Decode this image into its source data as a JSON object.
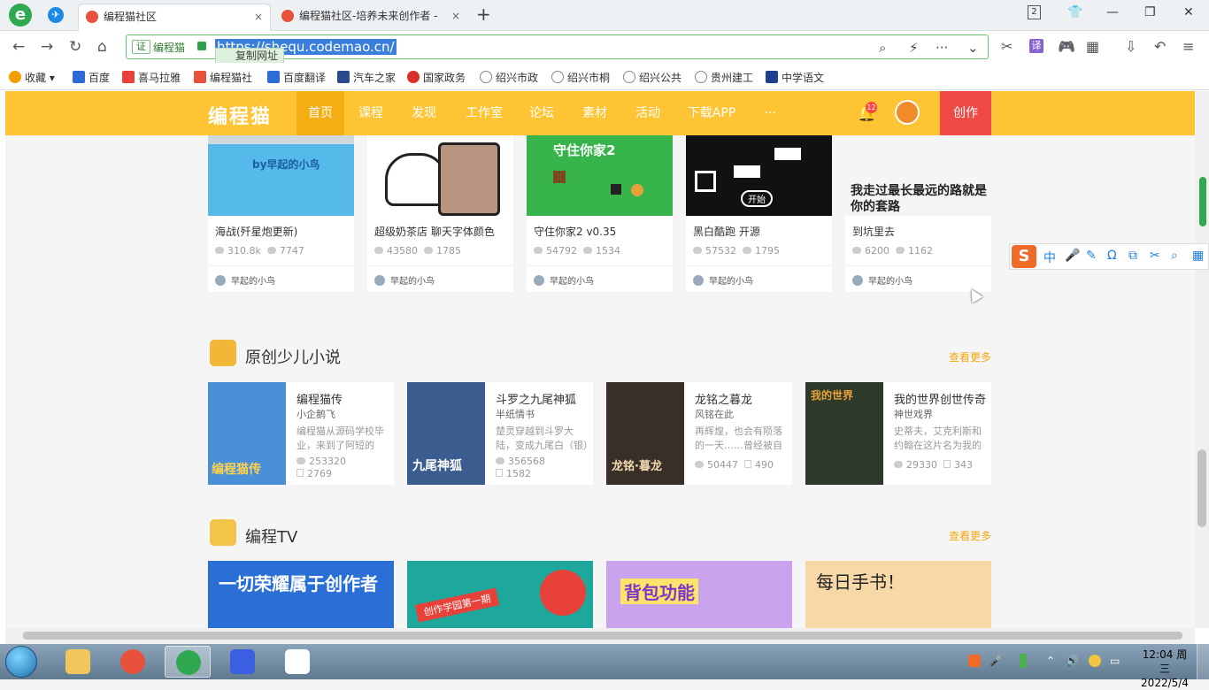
{
  "browser": {
    "tabs": [
      {
        "title": "编程猫社区",
        "close": "×"
      },
      {
        "title": "编程猫社区-培养未来创作者 -",
        "close": "×"
      }
    ],
    "new_tab": "+",
    "tab_count": "2",
    "window": {
      "minimize": "—",
      "maximize": "❐",
      "close": "✕"
    },
    "address": {
      "cert": "证",
      "site_name": "编程猫",
      "url": "https://shequ.codemao.cn/",
      "copy_tip": "复制网址"
    },
    "nav": {
      "back": "←",
      "forward": "→",
      "refresh": "↻",
      "home": "⌂"
    },
    "url_icons": {
      "search": "⌕",
      "flash": "⚡",
      "more": "···",
      "dropdown": "⌄"
    },
    "toolbar_icons": {
      "cut": "✂",
      "translate": "译",
      "game": "🎮",
      "apps": "▦",
      "download": "⇩",
      "undo": "↶",
      "menu": "≡"
    },
    "bookmarks": [
      {
        "label": "收藏",
        "color": "#f0a000"
      },
      {
        "label": "百度",
        "color": "#2f6bd6"
      },
      {
        "label": "喜马拉雅",
        "color": "#e8413a"
      },
      {
        "label": "编程猫社",
        "color": "#e8513b"
      },
      {
        "label": "百度翻译",
        "color": "#2f6bd6"
      },
      {
        "label": "汽车之家",
        "color": "#2a4a8e"
      },
      {
        "label": "国家政务",
        "color": "#d9302c"
      },
      {
        "label": "绍兴市政",
        "color": "#888888"
      },
      {
        "label": "绍兴市桐",
        "color": "#888888"
      },
      {
        "label": "绍兴公共",
        "color": "#888888"
      },
      {
        "label": "贵州建工",
        "color": "#888888"
      },
      {
        "label": "中学语文",
        "color": "#1f3f8f"
      }
    ]
  },
  "site": {
    "logo": "编程猫",
    "nav": [
      "首页",
      "课程",
      "发现",
      "工作室",
      "论坛",
      "素材",
      "活动",
      "下载APP",
      "···"
    ],
    "active_nav": "首页",
    "notifications": "12",
    "create": "创作",
    "games": [
      {
        "title": "海战(歼星炮更新)",
        "views": "310.8k",
        "likes": "7747",
        "author": "早起的小鸟",
        "thumb_text": "by早起的小鸟",
        "thumb_color": "#55b9ea"
      },
      {
        "title": "超级奶茶店 聊天字体颜色",
        "views": "43580",
        "likes": "1785",
        "author": "早起的小鸟",
        "thumb_text": "",
        "thumb_color": "#ffffff"
      },
      {
        "title": "守住你家2 v0.35",
        "views": "54792",
        "likes": "1534",
        "author": "早起的小鸟",
        "thumb_text": "守住你家2",
        "thumb_color": "#37b44a"
      },
      {
        "title": "黑白酷跑 开源",
        "views": "57532",
        "likes": "1795",
        "author": "早起的小鸟",
        "thumb_text": "开始",
        "thumb_color": "#111111"
      },
      {
        "title": "到坑里去",
        "views": "6200",
        "likes": "1162",
        "author": "早起的小鸟",
        "thumb_text": "我走过最长最远的路就是你的套路",
        "thumb_color": "#f5f5f5"
      }
    ],
    "novels_section": {
      "title": "原创少儿小说",
      "more": "查看更多"
    },
    "novels": [
      {
        "title": "编程猫传",
        "author": "小企鹅飞",
        "desc": "编程猫从源码学校毕业，来到了阿短的家…",
        "views": "253320",
        "likes": "2769",
        "cover_color": "#4a90d9",
        "cover_text": "编程猫传"
      },
      {
        "title": "斗罗之九尾神狐",
        "author": "半纸情书",
        "desc": "楚灵穿越到斗罗大陆，变成九尾白（银）狐…",
        "views": "356568",
        "likes": "1582",
        "cover_color": "#3b5c8f",
        "cover_text": "九尾神狐"
      },
      {
        "title": "龙铭之暮龙",
        "author": "风铭在此",
        "desc": "再辉煌，也会有陨落的一天……曾经被自己…",
        "views": "50447",
        "likes": "490",
        "cover_color": "#3a2e28",
        "cover_text": "龙铭·暮龙"
      },
      {
        "title": "我的世界创世传奇",
        "author": "神世戏界",
        "desc": "史蒂夫，艾克利斯和约翰在这片名为我的世…",
        "views": "29330",
        "likes": "343",
        "cover_color": "#2d3a2a",
        "cover_text": "我的世界"
      }
    ],
    "tv_section": {
      "title": "编程TV",
      "more": "查看更多"
    },
    "tv": [
      {
        "text": "一切荣耀属于创作者",
        "color": "#2a6fd6"
      },
      {
        "text": "创作学园第一期",
        "color": "#1ea79b"
      },
      {
        "text": "背包功能",
        "color": "#c9a3ee"
      },
      {
        "text": "每日手书！",
        "color": "#f6d9a6"
      }
    ]
  },
  "ime": {
    "logo": "S",
    "items": [
      "中",
      "🎤",
      "✎",
      "Ω",
      "⧉",
      "✂",
      "⌕",
      "▦"
    ]
  },
  "taskbar": {
    "clock_time": "12:04 周三",
    "clock_date": "2022/5/4"
  }
}
